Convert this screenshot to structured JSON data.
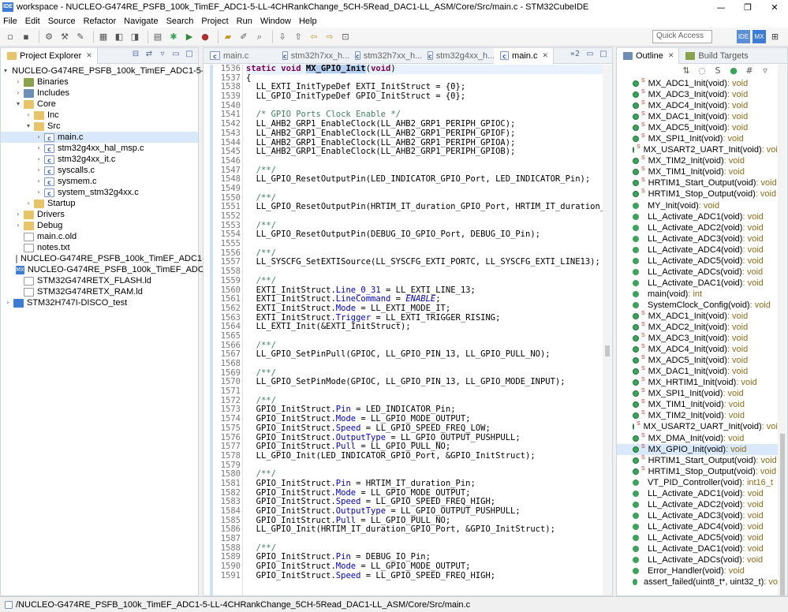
{
  "window": {
    "title": "workspace - NUCLEO-G474RE_PSFB_100k_TimEF_ADC1-5-LL-4CHRankChange_5CH-5Read_DAC1-LL_ASM/Core/Src/main.c - STM32CubeIDE",
    "app_icon": "IDE",
    "minimize": "—",
    "maximize": "❐",
    "close": "✕"
  },
  "menu": [
    "File",
    "Edit",
    "Source",
    "Refactor",
    "Navigate",
    "Search",
    "Project",
    "Run",
    "Window",
    "Help"
  ],
  "toolbar": {
    "quick_access_placeholder": "Quick Access",
    "perspective_ide": "IDE",
    "perspective_mx": "MX"
  },
  "project_explorer": {
    "tab_label": "Project Explorer",
    "items": [
      {
        "label": "NUCLEO-G474RE_PSFB_100k_TimEF_ADC1-5-LL-4CH",
        "indent": 0,
        "twist": "▾",
        "icon": "project"
      },
      {
        "label": "Binaries",
        "indent": 1,
        "twist": "›",
        "icon": "bin"
      },
      {
        "label": "Includes",
        "indent": 1,
        "twist": "›",
        "icon": "inc"
      },
      {
        "label": "Core",
        "indent": 1,
        "twist": "▾",
        "icon": "folder"
      },
      {
        "label": "Inc",
        "indent": 2,
        "twist": "›",
        "icon": "folder"
      },
      {
        "label": "Src",
        "indent": 2,
        "twist": "▾",
        "icon": "folder"
      },
      {
        "label": "main.c",
        "indent": 3,
        "twist": "›",
        "icon": "cfile",
        "selected": true
      },
      {
        "label": "stm32g4xx_hal_msp.c",
        "indent": 3,
        "twist": "›",
        "icon": "cfile"
      },
      {
        "label": "stm32g4xx_it.c",
        "indent": 3,
        "twist": "›",
        "icon": "cfile"
      },
      {
        "label": "syscalls.c",
        "indent": 3,
        "twist": "›",
        "icon": "cfile"
      },
      {
        "label": "sysmem.c",
        "indent": 3,
        "twist": "›",
        "icon": "cfile"
      },
      {
        "label": "system_stm32g4xx.c",
        "indent": 3,
        "twist": "›",
        "icon": "cfile"
      },
      {
        "label": "Startup",
        "indent": 2,
        "twist": "›",
        "icon": "folder"
      },
      {
        "label": "Drivers",
        "indent": 1,
        "twist": "›",
        "icon": "folder"
      },
      {
        "label": "Debug",
        "indent": 1,
        "twist": "›",
        "icon": "folder"
      },
      {
        "label": "main.c.old",
        "indent": 1,
        "twist": "",
        "icon": "file"
      },
      {
        "label": "notes.txt",
        "indent": 1,
        "twist": "",
        "icon": "file"
      },
      {
        "label": "NUCLEO-G474RE_PSFB_100k_TimEF_ADC1-5-LL-4",
        "indent": 1,
        "twist": "",
        "icon": "file"
      },
      {
        "label": "NUCLEO-G474RE_PSFB_100k_TimEF_ADC1-5-LL-4",
        "indent": 1,
        "twist": "",
        "icon": "mx"
      },
      {
        "label": "STM32G474RETX_FLASH.ld",
        "indent": 1,
        "twist": "",
        "icon": "file"
      },
      {
        "label": "STM32G474RETX_RAM.ld",
        "indent": 1,
        "twist": "",
        "icon": "file"
      },
      {
        "label": "STM32H747I-DISCO_test",
        "indent": 0,
        "twist": "›",
        "icon": "project"
      }
    ]
  },
  "editor": {
    "tabs": [
      {
        "label": "main.c",
        "active": false
      },
      {
        "label": "stm32h7xx_h...",
        "active": false
      },
      {
        "label": "stm32h7xx_h...",
        "active": false
      },
      {
        "label": "stm32g4xx_h...",
        "active": false
      },
      {
        "label": "main.c",
        "active": true
      }
    ],
    "overflow": "»2",
    "line_numbers": [
      "1536",
      "1537",
      "1538",
      "1539",
      "1540",
      "1541",
      "1542",
      "1543",
      "1544",
      "1545",
      "1546",
      "1547",
      "1548",
      "1549",
      "1550",
      "1551",
      "1552",
      "1553",
      "1554",
      "1555",
      "1556",
      "1557",
      "1558",
      "1559",
      "1560",
      "1561",
      "1562",
      "1563",
      "1564",
      "1565",
      "1566",
      "1567",
      "1568",
      "1569",
      "1570",
      "1571",
      "1572",
      "1573",
      "1574",
      "1575",
      "1576",
      "1577",
      "1578",
      "1579",
      "1580",
      "1581",
      "1582",
      "1583",
      "1584",
      "1585",
      "1586",
      "1587",
      "1588",
      "1589",
      "1590",
      "1591"
    ],
    "lines": [
      "static void MX_GPIO_Init(void)",
      "{",
      "  LL_EXTI_InitTypeDef EXTI_InitStruct = {0};",
      "  LL_GPIO_InitTypeDef GPIO_InitStruct = {0};",
      "",
      "  /* GPIO Ports Clock Enable */",
      "  LL_AHB2_GRP1_EnableClock(LL_AHB2_GRP1_PERIPH_GPIOC);",
      "  LL_AHB2_GRP1_EnableClock(LL_AHB2_GRP1_PERIPH_GPIOF);",
      "  LL_AHB2_GRP1_EnableClock(LL_AHB2_GRP1_PERIPH_GPIOA);",
      "  LL_AHB2_GRP1_EnableClock(LL_AHB2_GRP1_PERIPH_GPIOB);",
      "",
      "  /**/",
      "  LL_GPIO_ResetOutputPin(LED_INDICATOR_GPIO_Port, LED_INDICATOR_Pin);",
      "",
      "  /**/",
      "  LL_GPIO_ResetOutputPin(HRTIM_IT_duration_GPIO_Port, HRTIM_IT_duration_Pin);",
      "",
      "  /**/",
      "  LL_GPIO_ResetOutputPin(DEBUG_IO_GPIO_Port, DEBUG_IO_Pin);",
      "",
      "  /**/",
      "  LL_SYSCFG_SetEXTISource(LL_SYSCFG_EXTI_PORTC, LL_SYSCFG_EXTI_LINE13);",
      "",
      "  /**/",
      "  EXTI_InitStruct.Line_0_31 = LL_EXTI_LINE_13;",
      "  EXTI_InitStruct.LineCommand = ENABLE;",
      "  EXTI_InitStruct.Mode = LL_EXTI_MODE_IT;",
      "  EXTI_InitStruct.Trigger = LL_EXTI_TRIGGER_RISING;",
      "  LL_EXTI_Init(&EXTI_InitStruct);",
      "",
      "  /**/",
      "  LL_GPIO_SetPinPull(GPIOC, LL_GPIO_PIN_13, LL_GPIO_PULL_NO);",
      "",
      "  /**/",
      "  LL_GPIO_SetPinMode(GPIOC, LL_GPIO_PIN_13, LL_GPIO_MODE_INPUT);",
      "",
      "  /**/",
      "  GPIO_InitStruct.Pin = LED_INDICATOR_Pin;",
      "  GPIO_InitStruct.Mode = LL_GPIO_MODE_OUTPUT;",
      "  GPIO_InitStruct.Speed = LL_GPIO_SPEED_FREQ_LOW;",
      "  GPIO_InitStruct.OutputType = LL_GPIO_OUTPUT_PUSHPULL;",
      "  GPIO_InitStruct.Pull = LL_GPIO_PULL_NO;",
      "  LL_GPIO_Init(LED_INDICATOR_GPIO_Port, &GPIO_InitStruct);",
      "",
      "  /**/",
      "  GPIO_InitStruct.Pin = HRTIM_IT_duration_Pin;",
      "  GPIO_InitStruct.Mode = LL_GPIO_MODE_OUTPUT;",
      "  GPIO_InitStruct.Speed = LL_GPIO_SPEED_FREQ_HIGH;",
      "  GPIO_InitStruct.OutputType = LL_GPIO_OUTPUT_PUSHPULL;",
      "  GPIO_InitStruct.Pull = LL_GPIO_PULL_NO;",
      "  LL_GPIO_Init(HRTIM_IT_duration_GPIO_Port, &GPIO_InitStruct);",
      "",
      "  /**/",
      "  GPIO_InitStruct.Pin = DEBUG_IO_Pin;",
      "  GPIO_InitStruct.Mode = LL_GPIO_MODE_OUTPUT;",
      "  GPIO_InitStruct.Speed = LL_GPIO_SPEED_FREQ_HIGH;"
    ]
  },
  "outline": {
    "tab_label": "Outline",
    "tab2_label": "Build Targets",
    "items": [
      {
        "name": "MX_ADC1_Init(void)",
        "ret": " : void",
        "static": true
      },
      {
        "name": "MX_ADC3_Init(void)",
        "ret": " : void",
        "static": true
      },
      {
        "name": "MX_ADC4_Init(void)",
        "ret": " : void",
        "static": true
      },
      {
        "name": "MX_DAC1_Init(void)",
        "ret": " : void",
        "static": true
      },
      {
        "name": "MX_ADC5_Init(void)",
        "ret": " : void",
        "static": true
      },
      {
        "name": "MX_SPI1_Init(void)",
        "ret": " : void",
        "static": true
      },
      {
        "name": "MX_USART2_UART_Init(void)",
        "ret": " : void",
        "static": true
      },
      {
        "name": "MX_TIM2_Init(void)",
        "ret": " : void",
        "static": true
      },
      {
        "name": "MX_TIM1_Init(void)",
        "ret": " : void",
        "static": true
      },
      {
        "name": "HRTIM1_Start_Output(void)",
        "ret": " : void",
        "static": true
      },
      {
        "name": "HRTIM1_Stop_Output(void)",
        "ret": " : void",
        "static": true
      },
      {
        "name": "MY_Init(void)",
        "ret": " : void",
        "static": false
      },
      {
        "name": "LL_Activate_ADC1(void)",
        "ret": " : void",
        "static": false
      },
      {
        "name": "LL_Activate_ADC2(void)",
        "ret": " : void",
        "static": false
      },
      {
        "name": "LL_Activate_ADC3(void)",
        "ret": " : void",
        "static": false
      },
      {
        "name": "LL_Activate_ADC4(void)",
        "ret": " : void",
        "static": false
      },
      {
        "name": "LL_Activate_ADC5(void)",
        "ret": " : void",
        "static": false
      },
      {
        "name": "LL_Activate_ADCs(void)",
        "ret": " : void",
        "static": false
      },
      {
        "name": "LL_Activate_DAC1(void)",
        "ret": " : void",
        "static": false
      },
      {
        "name": "main(void)",
        "ret": " : int",
        "static": false
      },
      {
        "name": "SystemClock_Config(void)",
        "ret": " : void",
        "static": false
      },
      {
        "name": "MX_ADC1_Init(void)",
        "ret": " : void",
        "static": true
      },
      {
        "name": "MX_ADC2_Init(void)",
        "ret": " : void",
        "static": true
      },
      {
        "name": "MX_ADC3_Init(void)",
        "ret": " : void",
        "static": true
      },
      {
        "name": "MX_ADC4_Init(void)",
        "ret": " : void",
        "static": true
      },
      {
        "name": "MX_ADC5_Init(void)",
        "ret": " : void",
        "static": true
      },
      {
        "name": "MX_DAC1_Init(void)",
        "ret": " : void",
        "static": true
      },
      {
        "name": "MX_HRTIM1_Init(void)",
        "ret": " : void",
        "static": true
      },
      {
        "name": "MX_SPI1_Init(void)",
        "ret": " : void",
        "static": true
      },
      {
        "name": "MX_TIM1_Init(void)",
        "ret": " : void",
        "static": true
      },
      {
        "name": "MX_TIM2_Init(void)",
        "ret": " : void",
        "static": true
      },
      {
        "name": "MX_USART2_UART_Init(void)",
        "ret": " : void",
        "static": true
      },
      {
        "name": "MX_DMA_Init(void)",
        "ret": " : void",
        "static": true
      },
      {
        "name": "MX_GPIO_Init(void)",
        "ret": " : void",
        "static": true,
        "selected": true
      },
      {
        "name": "HRTIM1_Start_Output(void)",
        "ret": " : void",
        "static": true
      },
      {
        "name": "HRTIM1_Stop_Output(void)",
        "ret": " : void",
        "static": true
      },
      {
        "name": "VT_PID_Controller(void)",
        "ret": " : int16_t",
        "static": false
      },
      {
        "name": "LL_Activate_ADC1(void)",
        "ret": " : void",
        "static": false
      },
      {
        "name": "LL_Activate_ADC2(void)",
        "ret": " : void",
        "static": false
      },
      {
        "name": "LL_Activate_ADC3(void)",
        "ret": " : void",
        "static": false
      },
      {
        "name": "LL_Activate_ADC4(void)",
        "ret": " : void",
        "static": false
      },
      {
        "name": "LL_Activate_ADC5(void)",
        "ret": " : void",
        "static": false
      },
      {
        "name": "LL_Activate_DAC1(void)",
        "ret": " : void",
        "static": false
      },
      {
        "name": "LL_Activate_ADCs(void)",
        "ret": " : void",
        "static": false
      },
      {
        "name": "Error_Handler(void)",
        "ret": " : void",
        "static": false
      },
      {
        "name": "assert_failed(uint8_t*, uint32_t)",
        "ret": " : vo",
        "static": false
      }
    ]
  },
  "status": {
    "path": "/NUCLEO-G474RE_PSFB_100k_TimEF_ADC1-5-LL-4CHRankChange_5CH-5Read_DAC1-LL_ASM/Core/Src/main.c"
  }
}
